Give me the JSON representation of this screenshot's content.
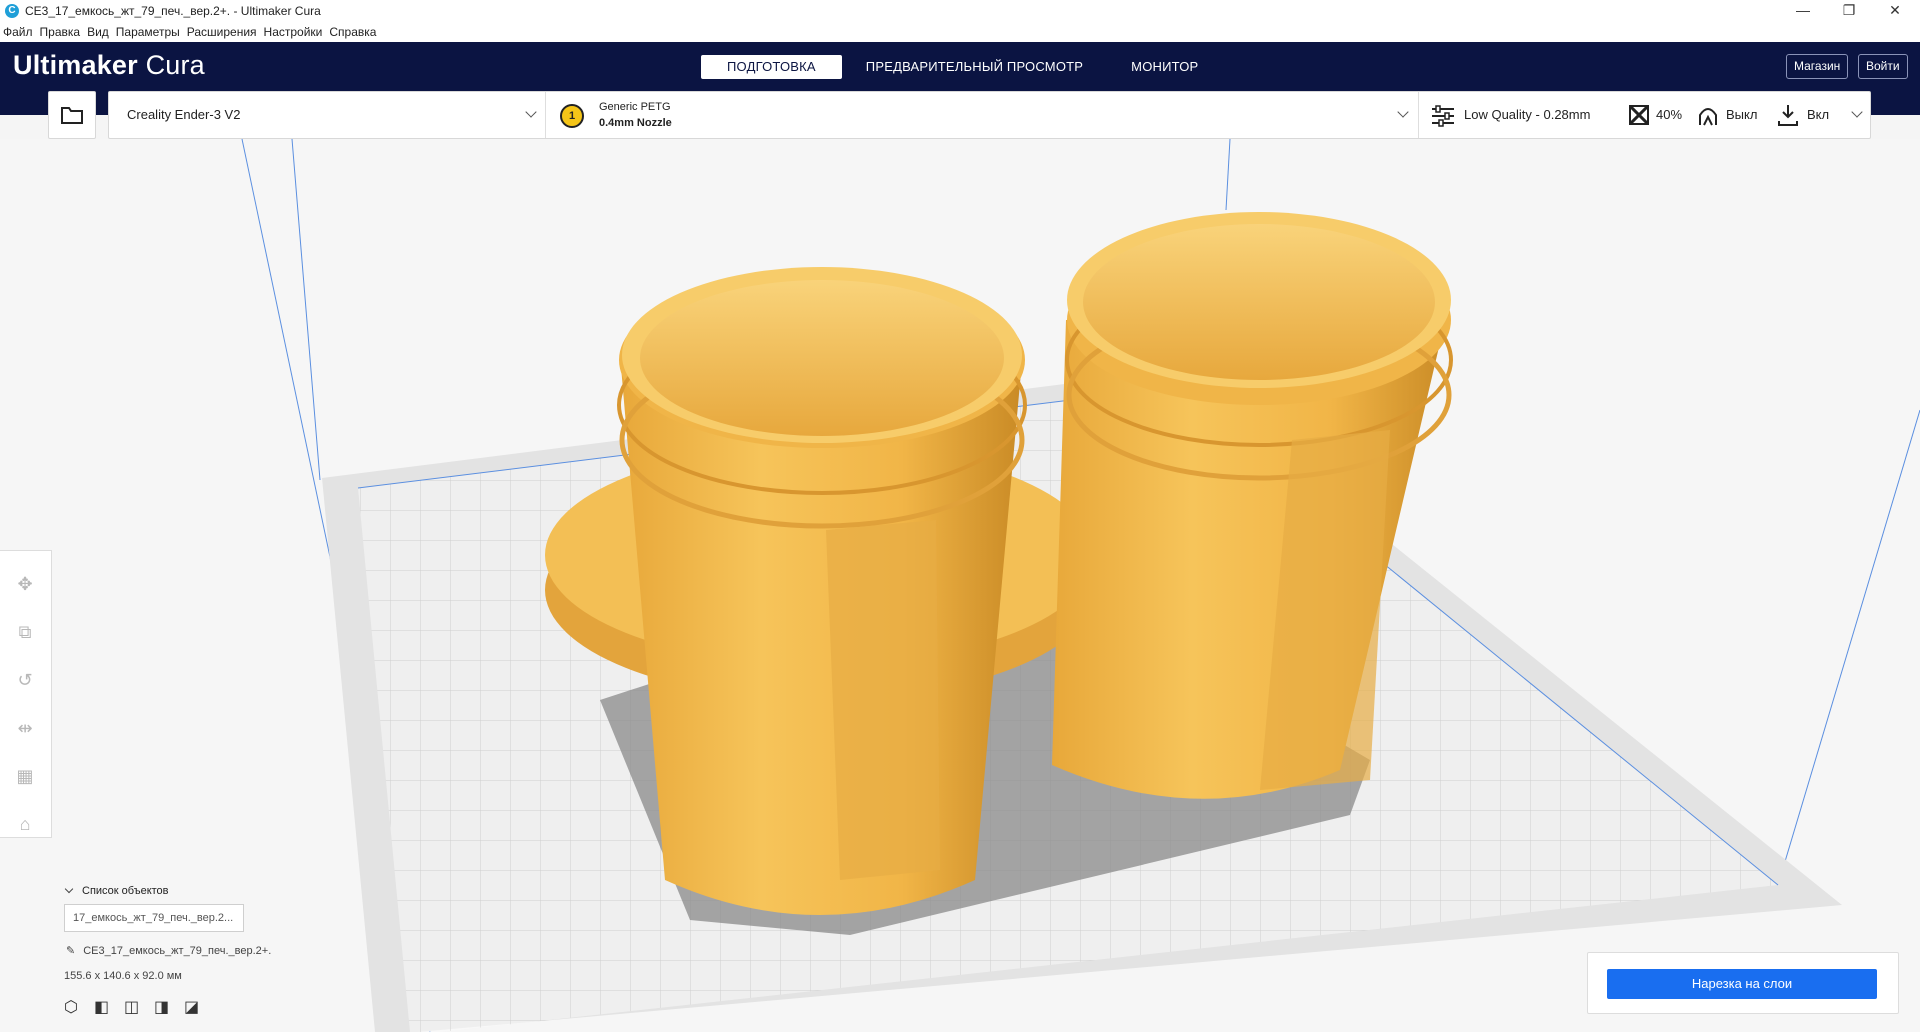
{
  "window": {
    "title": "CE3_17_емкось_жт_79_печ._вер.2+. - Ultimaker Cura",
    "app_icon": "C",
    "minimize": "—",
    "maximize": "❐",
    "close": "✕"
  },
  "menu": [
    "Файл",
    "Правка",
    "Вид",
    "Параметры",
    "Расширения",
    "Настройки",
    "Справка"
  ],
  "header": {
    "logo_bold": "Ultimaker",
    "logo_light": "Cura",
    "stages": [
      "ПОДГОТОВКА",
      "ПРЕДВАРИТЕЛЬНЫЙ ПРОСМОТР",
      "МОНИТОР"
    ],
    "active_stage": "ПОДГОТОВКА",
    "marketplace": "Магазин",
    "signin": "Войти"
  },
  "printer": {
    "machine": "Creality Ender-3 V2",
    "extruder_number": "1",
    "material": "Generic PETG",
    "nozzle": "0.4mm Nozzle",
    "profile": "Low Quality - 0.28mm",
    "infill": "40%",
    "support": "Выкл",
    "adhesion": "Вкл"
  },
  "objects": {
    "list_title": "Список объектов",
    "list_item": "17_емкось_жт_79_печ._вер.2...",
    "object_name": "CE3_17_емкось_жт_79_печ._вер.2+.",
    "dimensions": "155.6 x 140.6 x 92.0 мм"
  },
  "slice": {
    "button": "Нарезка на слои"
  },
  "colors": {
    "header_bg": "#0b1442",
    "model": "#f5c04a",
    "accent": "#196ef0"
  }
}
